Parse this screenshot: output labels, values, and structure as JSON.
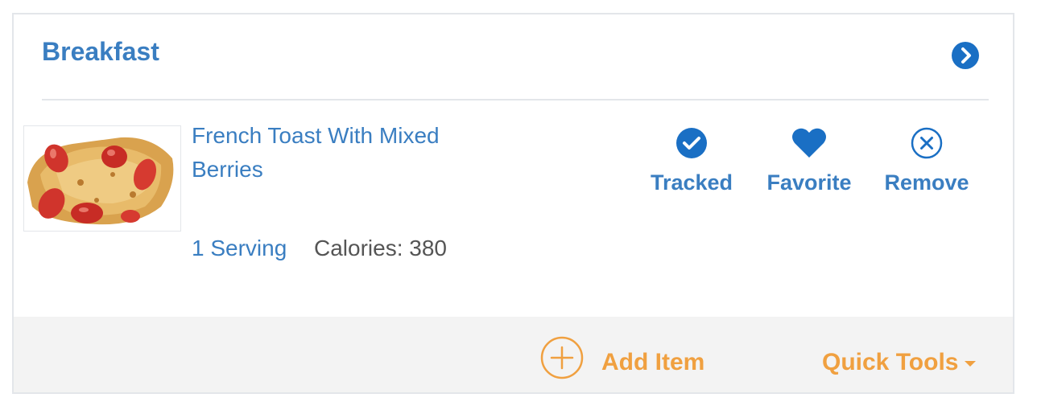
{
  "meal": {
    "title": "Breakfast",
    "expand_icon": "chevron-right-circle-icon"
  },
  "item": {
    "name": "French Toast With Mixed Berries",
    "image": "french-toast-with-strawberries",
    "serving": "1 Serving",
    "calories": "Calories: 380",
    "actions": [
      {
        "label": "Tracked",
        "icon": "check-circle-icon"
      },
      {
        "label": "Favorite",
        "icon": "heart-icon"
      },
      {
        "label": "Remove",
        "icon": "close-circle-icon"
      }
    ]
  },
  "footer": {
    "add_item": "Add Item",
    "add_icon": "plus-circle-icon",
    "quick_tools": "Quick Tools",
    "quick_tools_icon": "caret-down-icon"
  },
  "colors": {
    "primary": "#3a7ec1",
    "accent": "#f0a040",
    "muted_text": "#555555",
    "footer_bg": "#f3f3f3",
    "border": "#e3e6ea"
  }
}
